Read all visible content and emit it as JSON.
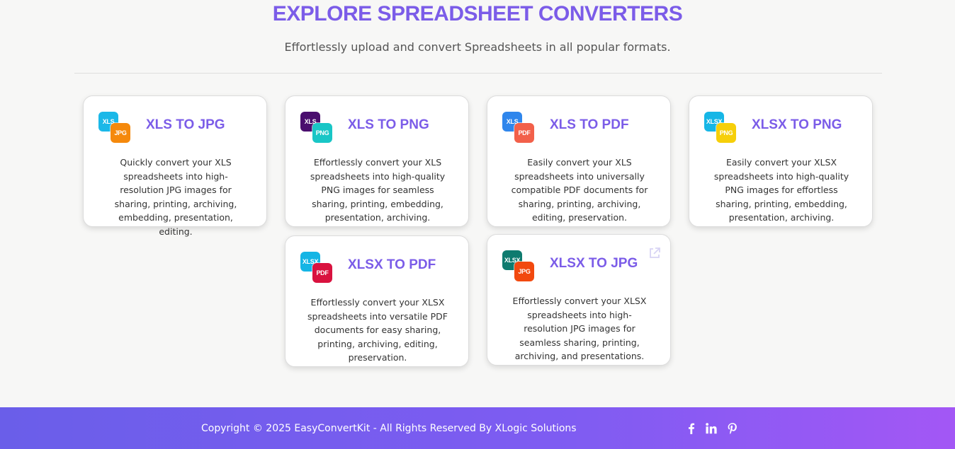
{
  "header": {
    "title": "EXPLORE SPREADSHEET CONVERTERS",
    "subtitle": "Effortlessly upload and convert Spreadsheets in all popular formats."
  },
  "colors": {
    "accent": "#7b5ce8",
    "footer_start": "#6a5ee9",
    "footer_end": "#a357f5"
  },
  "cards": [
    {
      "title": "XLS TO JPG",
      "from": {
        "label": "XLS",
        "color": "#1bb8e8"
      },
      "to": {
        "label": "JPG",
        "color": "#f5890c"
      },
      "description": "Quickly convert your XLS spreadsheets into high-resolution JPG images for sharing, printing, archiving, embedding, presentation, editing."
    },
    {
      "title": "XLS TO PNG",
      "from": {
        "label": "XLS",
        "color": "#4a0e6e"
      },
      "to": {
        "label": "PNG",
        "color": "#19c6c6"
      },
      "description": "Effortlessly convert your XLS spreadsheets into high-quality PNG images for seamless sharing, printing, embedding, presentation, archiving."
    },
    {
      "title": "XLS TO PDF",
      "from": {
        "label": "XLS",
        "color": "#2f86ec"
      },
      "to": {
        "label": "PDF",
        "color": "#f2604a"
      },
      "description": "Easily convert your XLS spreadsheets into universally compatible PDF documents for sharing, printing, archiving, editing, preservation."
    },
    {
      "title": "XLSX TO PNG",
      "from": {
        "label": "XLSX",
        "color": "#16b6e6"
      },
      "to": {
        "label": "PNG",
        "color": "#f6cf0a"
      },
      "description": "Easily convert your XLSX spreadsheets into high-quality PNG images for effortless sharing, printing, embedding, presentation, archiving."
    },
    {
      "title": "XLSX TO PDF",
      "from": {
        "label": "XLSX",
        "color": "#14b5e5"
      },
      "to": {
        "label": "PDF",
        "color": "#d9123f"
      },
      "description": "Effortlessly convert your XLSX spreadsheets into versatile PDF documents for easy sharing, printing, archiving, editing, preservation."
    },
    {
      "title": "XLSX TO JPG",
      "from": {
        "label": "XLSX",
        "color": "#0f7b6f"
      },
      "to": {
        "label": "JPG",
        "color": "#f2490f"
      },
      "description": "Effortlessly convert your XLSX spreadsheets into high-resolution JPG images for seamless sharing, printing, archiving, and presentations."
    }
  ],
  "footer": {
    "copyright": "Copyright © 2025 EasyConvertKit - All Rights Reserved By XLogic Solutions",
    "social": [
      "facebook-icon",
      "linkedin-icon",
      "pinterest-icon"
    ]
  }
}
